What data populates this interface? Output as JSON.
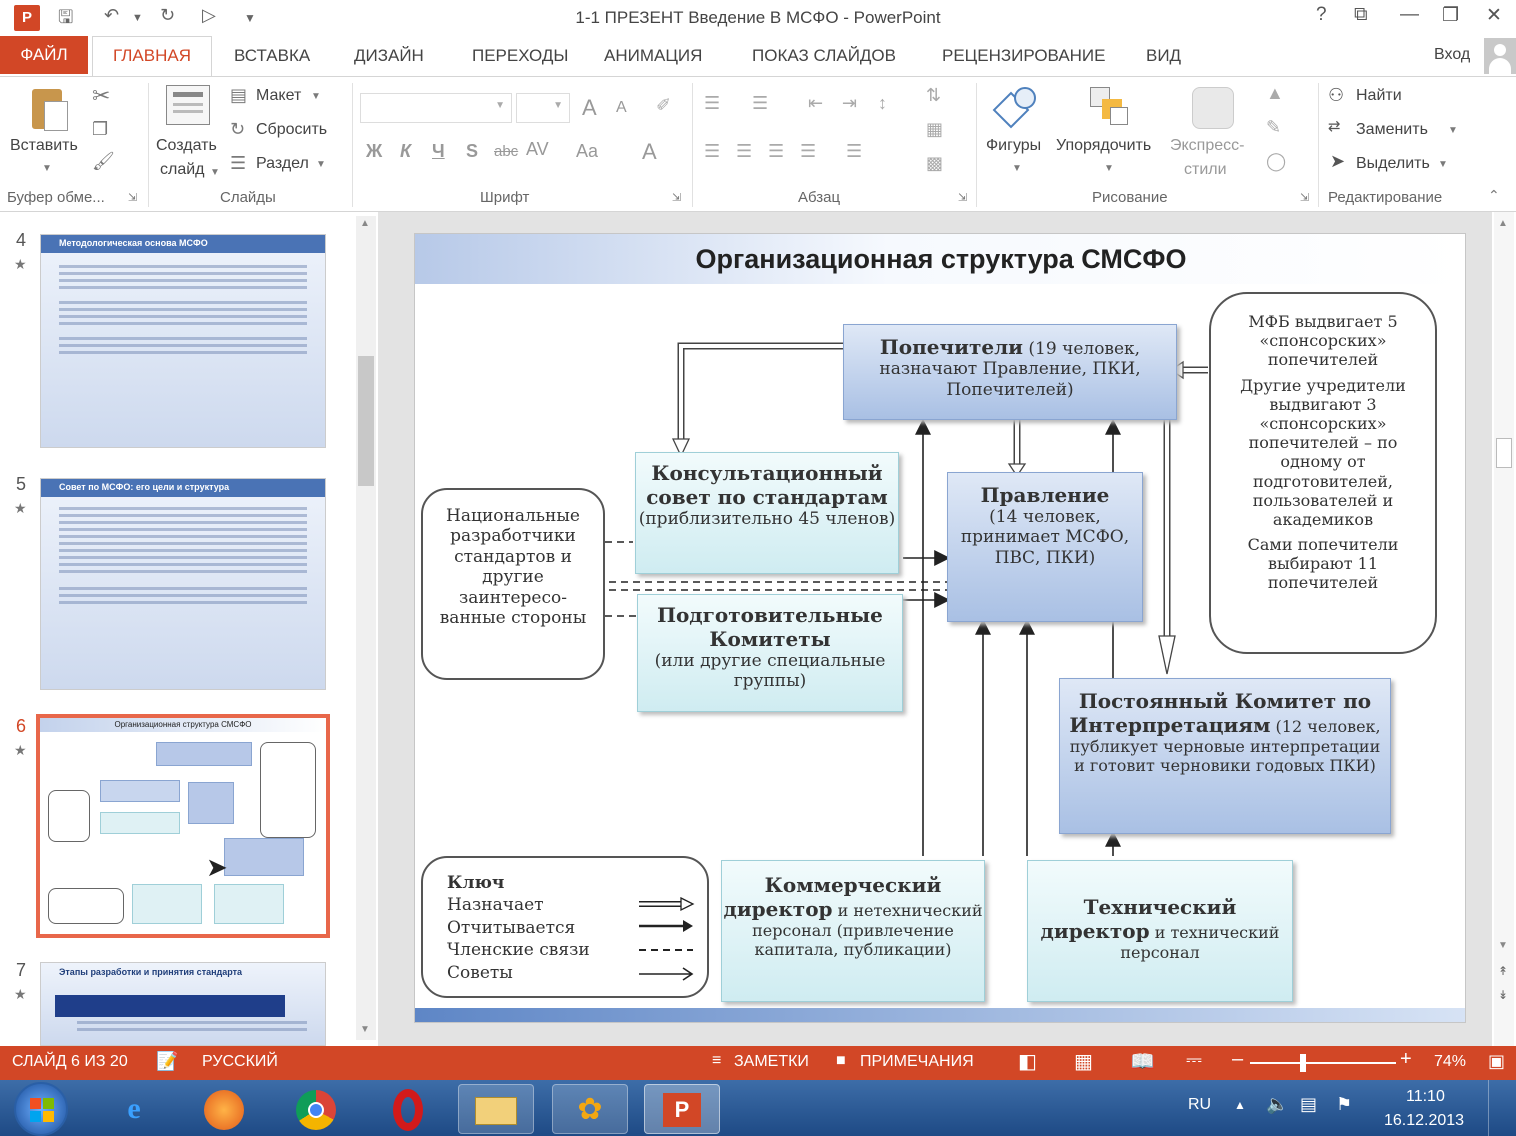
{
  "window": {
    "title": "1-1  ПРЕЗЕНТ  Введение  В МСФО - PowerPoint",
    "help": "?",
    "sign_in": "Вход"
  },
  "tabs": [
    "ФАЙЛ",
    "ГЛАВНАЯ",
    "ВСТАВКА",
    "ДИЗАЙН",
    "ПЕРЕХОДЫ",
    "АНИМАЦИЯ",
    "ПОКАЗ СЛАЙДОВ",
    "РЕЦЕНЗИРОВАНИЕ",
    "ВИД"
  ],
  "ribbon": {
    "clipboard": {
      "paste": "Вставить",
      "label": "Буфер обме..."
    },
    "slides": {
      "new_slide_1": "Создать",
      "new_slide_2": "слайд",
      "layout": "Макет",
      "reset": "Сбросить",
      "section": "Раздел",
      "label": "Слайды"
    },
    "font": {
      "label": "Шрифт",
      "bold": "Ж",
      "italic": "К",
      "underline": "Ч",
      "shadow": "S",
      "strike": "abc",
      "spacing": "AV",
      "case": "Aa",
      "color": "A",
      "grow": "A",
      "shrink": "A"
    },
    "paragraph": {
      "label": "Абзац"
    },
    "drawing": {
      "shapes": "Фигуры",
      "arrange": "Упорядочить",
      "quick_styles_1": "Экспресс-",
      "quick_styles_2": "стили",
      "label": "Рисование"
    },
    "editing": {
      "find": "Найти",
      "replace": "Заменить",
      "select": "Выделить",
      "label": "Редактирование"
    }
  },
  "thumbnails": [
    {
      "num": "4",
      "title": "Методологическая основа МСФО"
    },
    {
      "num": "5",
      "title": "Совет по МСФО: его цели и структура"
    },
    {
      "num": "6",
      "title": "Организационная структура СМСФО"
    },
    {
      "num": "7",
      "title": "Этапы разработки и принятия стандарта"
    }
  ],
  "slide": {
    "title": "Организационная структура СМСФО",
    "trustees_bold": "Попечители",
    "trustees_rest": "(19 человек, назначают Правление, ПКИ, Попечителей)",
    "advisory_bold": "Консультационный совет по стандартам",
    "advisory_rest": "(приблизительно  45 членов)",
    "board_bold": "Правление",
    "board_rest": "(14 человек, принимает МСФО, ПВС, ПКИ)",
    "national": "Национальные разработчики стандартов и другие заинтересо-ванные стороны",
    "prep_bold": "Подготовительные Комитеты",
    "prep_rest": "(или другие специальные группы)",
    "ifb_1": "МФБ выдвигает 5 «спонсорских» попечителей",
    "ifb_2": "Другие учредители выдвигают 3 «спонсорских» попечителей – по одному от подготовителей, пользователей и академиков",
    "ifb_3": "Сами попечители выбирают 11 попечителей",
    "sic_bold": "Постоянный Комитет по Интерпретациям",
    "sic_rest": "(12 человек, публикует черновые интерпретации и готовит черновики годовых ПКИ)",
    "key_title": "Ключ",
    "key_items": [
      "Назначает",
      "Отчитывается",
      "Членские связи",
      "Советы"
    ],
    "commercial_bold": "Коммерческий директор",
    "commercial_rest": "и нетехнический персонал (привлечение капитала, публикации)",
    "technical_bold": "Технический директор",
    "technical_rest": "и технический персонал"
  },
  "status": {
    "slide": "СЛАЙД 6 ИЗ 20",
    "language": "РУССКИЙ",
    "notes": "ЗАМЕТКИ",
    "comments": "ПРИМЕЧАНИЯ",
    "zoom": "74%"
  },
  "taskbar": {
    "lang": "RU",
    "time": "11:10",
    "date": "16.12.2013"
  },
  "colors": {
    "accent": "#d24726",
    "diagram_blue": "#a9c0e4",
    "diagram_cyan": "#cfecf1"
  }
}
